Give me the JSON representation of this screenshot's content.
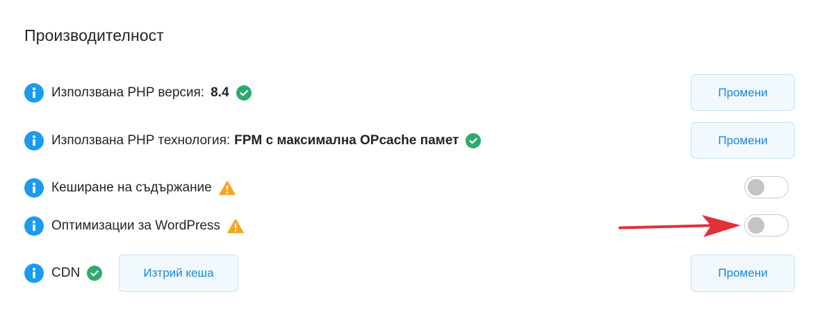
{
  "section": {
    "title": "Производителност"
  },
  "rows": [
    {
      "label": "Използвана PHP версия:",
      "value": "8.4",
      "status": "ok",
      "button": "Промени"
    },
    {
      "label": "Използвана PHP технология:",
      "value": "FPM с максимална OPcache памет",
      "status": "ok",
      "button": "Промени"
    },
    {
      "label": "Кеширане на съдържание",
      "status": "warning",
      "toggle": false
    },
    {
      "label": "Оптимизации за WordPress",
      "status": "warning",
      "toggle": false
    },
    {
      "label": "CDN",
      "status": "ok",
      "inline_button": "Изтрий кеша",
      "button": "Промени"
    }
  ],
  "colors": {
    "info": "#1a9bef",
    "ok": "#2faa6e",
    "warning": "#f5a623",
    "button_text": "#1587d8",
    "arrow": "#e0303a"
  },
  "icons": [
    "info-icon",
    "check-circle-icon",
    "warning-triangle-icon",
    "red-arrow-annotation"
  ]
}
